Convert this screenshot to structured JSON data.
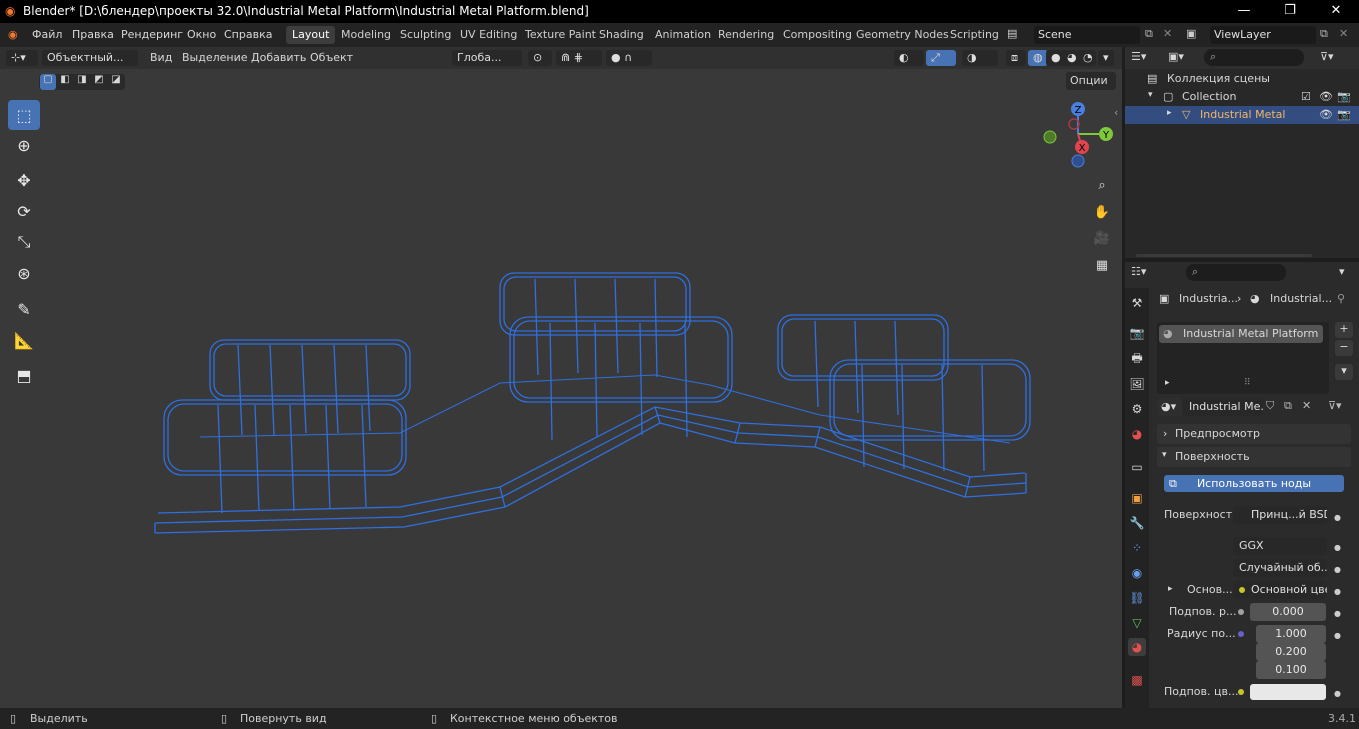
{
  "window": {
    "title": "Blender* [D:\\блендер\\проекты 32.0\\Industrial Metal Platform\\Industrial Metal Platform.blend]",
    "minimize": "—",
    "maximize": "❐",
    "close": "✕"
  },
  "menu": [
    "Файл",
    "Правка",
    "Рендеринг",
    "Окно",
    "Справка"
  ],
  "workspaces": [
    {
      "label": "Layout",
      "active": true
    },
    {
      "label": "Modeling"
    },
    {
      "label": "Sculpting"
    },
    {
      "label": "UV Editing"
    },
    {
      "label": "Texture Paint"
    },
    {
      "label": "Shading"
    },
    {
      "label": "Animation"
    },
    {
      "label": "Rendering"
    },
    {
      "label": "Compositing"
    },
    {
      "label": "Geometry Nodes"
    },
    {
      "label": "Scripting"
    }
  ],
  "scene": {
    "name": "Scene",
    "view_layer": "ViewLayer"
  },
  "viewport_header": {
    "mode": "Объектный...",
    "menus": [
      "Вид",
      "Выделение",
      "Добавить",
      "Объект"
    ],
    "orientation": "Глоба...",
    "options": "Опции"
  },
  "gizmo": {
    "z": "Z",
    "y": "Y",
    "x": "X"
  },
  "outliner": {
    "search_placeholder": "",
    "scene_collection": "Коллекция сцены",
    "collection": "Collection",
    "object": "Industrial Metal Platfo"
  },
  "properties": {
    "breadcrumb_object": "Industria...",
    "breadcrumb_material": "Industrial...",
    "material_slot": "Industrial Metal Platform",
    "material_name": "Industrial Me...",
    "panel_preview": "Предпросмотр",
    "panel_surface": "Поверхность",
    "use_nodes": "Использовать ноды",
    "surface_label": "Поверхность",
    "surface_value": "Принц...й BSDF",
    "distribution": "GGX",
    "subsurface_method": "Случайный об...",
    "base_label": "Основ...",
    "base_value": "Основной цвет",
    "subsurface_label": "Подпов. р...",
    "subsurface_value": "0.000",
    "radius_label": "Радиус по...",
    "radius_values": [
      "1.000",
      "0.200",
      "0.100"
    ],
    "subsurface_color_label": "Подпов. цв..."
  },
  "status": {
    "select": "Выделить",
    "rotate": "Повернуть вид",
    "context": "Контекстное меню объектов",
    "version": "3.4.1"
  },
  "colors": {
    "accent": "#4772b3",
    "wire": "#2f6fe0",
    "object_name": "#f0b66a"
  }
}
